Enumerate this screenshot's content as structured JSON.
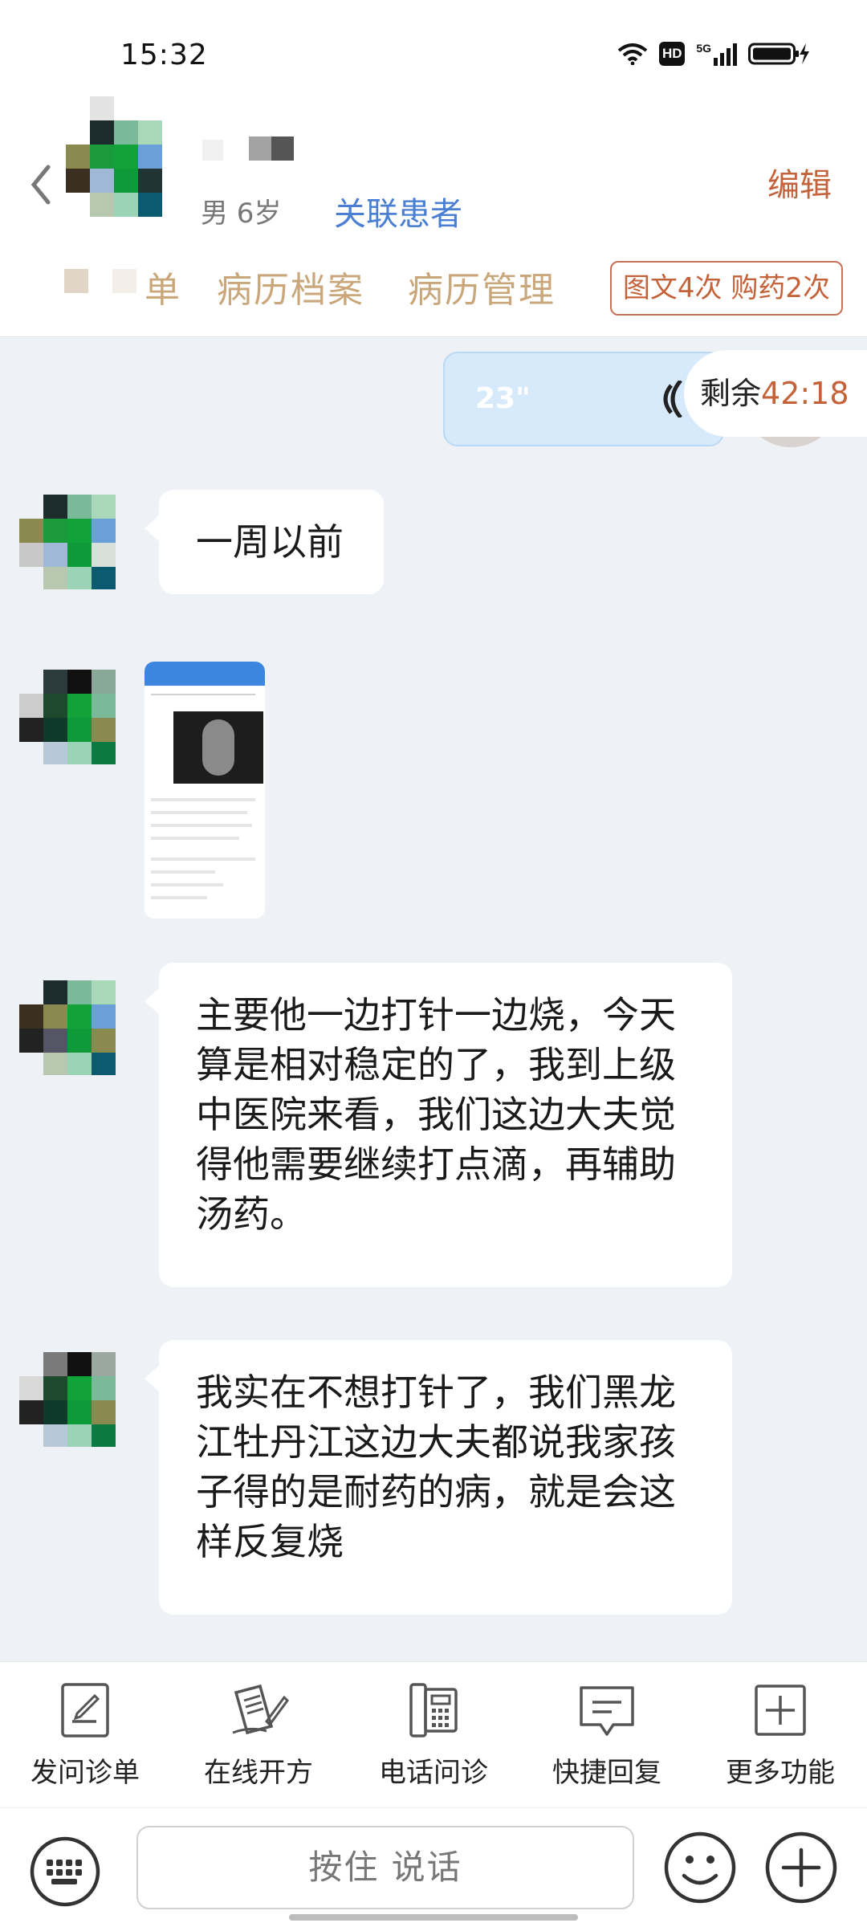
{
  "status_bar": {
    "time": "15:32",
    "network": "5G",
    "hd_badge": "HD",
    "icons": [
      "wifi-icon",
      "hd-icon",
      "signal-5g-icon",
      "battery-charging-icon"
    ]
  },
  "header": {
    "edit_label": "编辑",
    "patient_meta": "男 6岁",
    "link_patient_label": "关联患者",
    "tabs": [
      "单",
      "病历档案",
      "病历管理"
    ],
    "badge_label": "图文4次 购药2次"
  },
  "chat": {
    "voice_duration": "23\"",
    "timer_prefix": "剩余",
    "timer_value": "42:18",
    "messages": [
      {
        "type": "text",
        "text": "一周以前"
      },
      {
        "type": "image"
      },
      {
        "type": "text",
        "text": "主要他一边打针一边烧，今天算是相对稳定的了，我到上级中医院来看，我们这边大夫觉得他需要继续打点滴，再辅助汤药。"
      },
      {
        "type": "text",
        "text": "我实在不想打针了，我们黑龙江牡丹江这边大夫都说我家孩子得的是耐药的病，就是会这样反复烧"
      }
    ]
  },
  "tools": [
    {
      "label": "发问诊单",
      "icon": "form-icon"
    },
    {
      "label": "在线开方",
      "icon": "prescription-icon"
    },
    {
      "label": "电话问诊",
      "icon": "phone-icon"
    },
    {
      "label": "快捷回复",
      "icon": "quick-reply-icon"
    },
    {
      "label": "更多功能",
      "icon": "more-icon"
    }
  ],
  "input_bar": {
    "hold_to_talk": "按住 说话"
  },
  "colors": {
    "accent_orange": "#c4623a",
    "link_blue": "#4a7fd3",
    "tab_gold": "#c9a77a",
    "chat_bg": "#eef1f6",
    "voice_bubble": "#d6eafb"
  }
}
